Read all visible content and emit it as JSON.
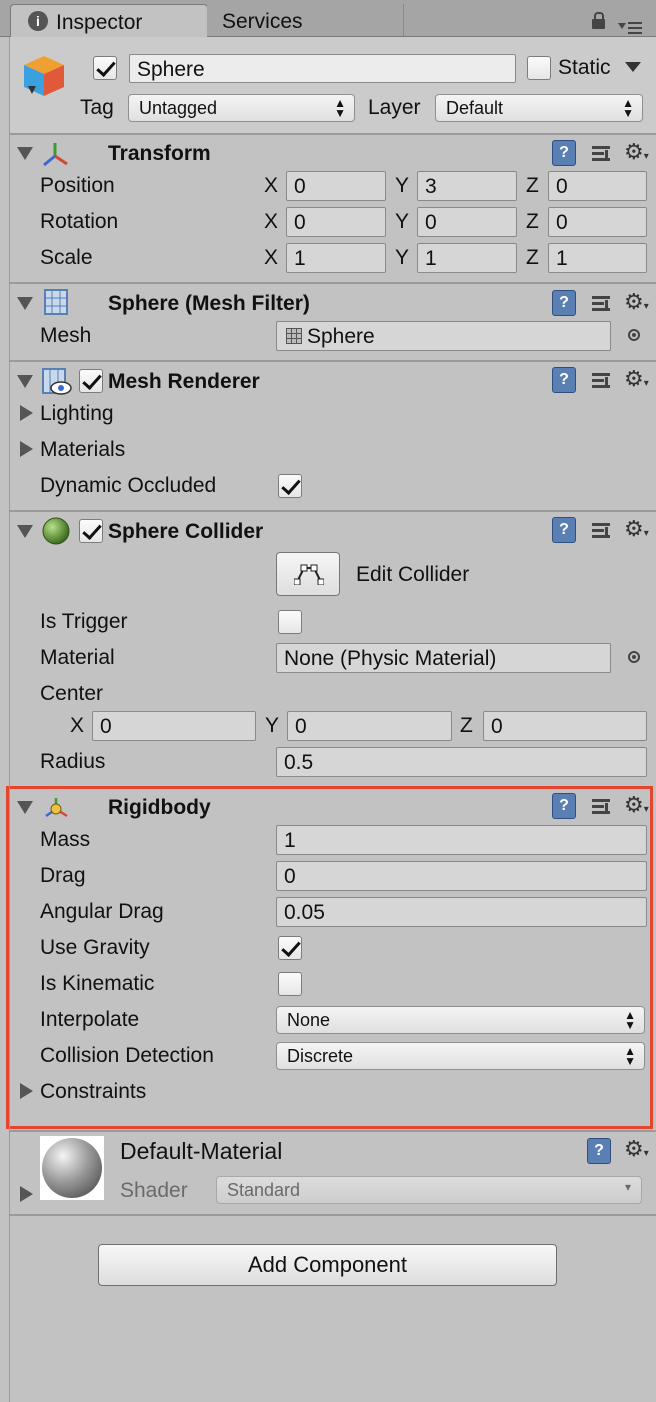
{
  "tabs": [
    {
      "label": "Inspector",
      "icon": "info-icon",
      "active": true
    },
    {
      "label": "Services",
      "active": false
    }
  ],
  "header": {
    "object_name": "Sphere",
    "active_checked": true,
    "static_label": "Static",
    "static_checked": false,
    "tag_label": "Tag",
    "tag_value": "Untagged",
    "layer_label": "Layer",
    "layer_value": "Default"
  },
  "transform": {
    "title": "Transform",
    "position_label": "Position",
    "rotation_label": "Rotation",
    "scale_label": "Scale",
    "axis_x": "X",
    "axis_y": "Y",
    "axis_z": "Z",
    "position": {
      "x": "0",
      "y": "3",
      "z": "0"
    },
    "rotation": {
      "x": "0",
      "y": "0",
      "z": "0"
    },
    "scale": {
      "x": "1",
      "y": "1",
      "z": "1"
    }
  },
  "mesh_filter": {
    "title": "Sphere (Mesh Filter)",
    "mesh_label": "Mesh",
    "mesh_value": "Sphere"
  },
  "mesh_renderer": {
    "title": "Mesh Renderer",
    "enabled": true,
    "lighting_label": "Lighting",
    "materials_label": "Materials",
    "dynamic_occluded_label": "Dynamic Occluded",
    "dynamic_occluded": true
  },
  "sphere_collider": {
    "title": "Sphere Collider",
    "enabled": true,
    "edit_collider_label": "Edit Collider",
    "is_trigger_label": "Is Trigger",
    "is_trigger": false,
    "material_label": "Material",
    "material_value": "None (Physic Material)",
    "center_label": "Center",
    "center": {
      "x": "0",
      "y": "0",
      "z": "0"
    },
    "radius_label": "Radius",
    "radius_value": "0.5"
  },
  "rigidbody": {
    "title": "Rigidbody",
    "highlight_color": "#e5452f",
    "mass_label": "Mass",
    "mass_value": "1",
    "drag_label": "Drag",
    "drag_value": "0",
    "angular_drag_label": "Angular Drag",
    "angular_drag_value": "0.05",
    "use_gravity_label": "Use Gravity",
    "use_gravity": true,
    "is_kinematic_label": "Is Kinematic",
    "is_kinematic": false,
    "interpolate_label": "Interpolate",
    "interpolate_value": "None",
    "collision_detection_label": "Collision Detection",
    "collision_detection_value": "Discrete",
    "constraints_label": "Constraints"
  },
  "material": {
    "name": "Default-Material",
    "shader_label": "Shader",
    "shader_value": "Standard"
  },
  "add_component_label": "Add Component"
}
